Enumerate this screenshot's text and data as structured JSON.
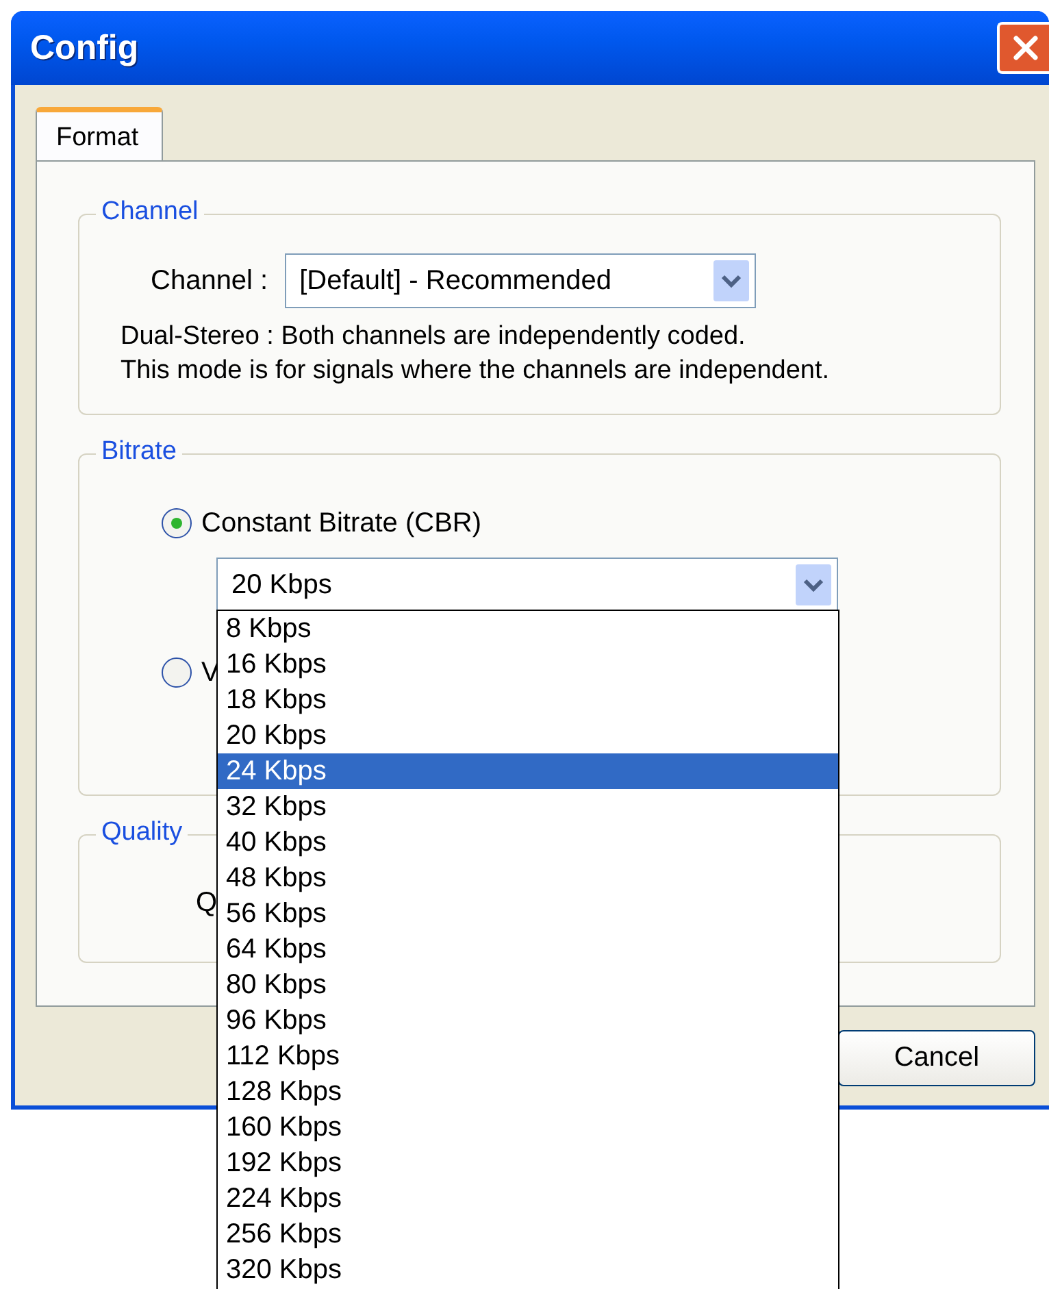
{
  "window": {
    "title": "Config"
  },
  "tabs": [
    {
      "label": "Format",
      "selected": true
    }
  ],
  "channel_group": {
    "legend": "Channel",
    "label": "Channel :",
    "value": "[Default] - Recommended",
    "description": [
      "Dual-Stereo : Both channels are independently coded.",
      "This mode is for signals where the channels are independent."
    ]
  },
  "bitrate_group": {
    "legend": "Bitrate",
    "options": [
      {
        "label": "Constant Bitrate (CBR)",
        "selected": true
      },
      {
        "label": "V",
        "selected": false
      }
    ],
    "value": "20 Kbps"
  },
  "quality_group": {
    "legend": "Quality",
    "label": "Q"
  },
  "buttons": [
    "Cancel"
  ],
  "dropdown_list": [
    {
      "label": "8 Kbps",
      "selected": false
    },
    {
      "label": "16 Kbps",
      "selected": false
    },
    {
      "label": "18 Kbps",
      "selected": false
    },
    {
      "label": "20 Kbps",
      "selected": false
    },
    {
      "label": "24 Kbps",
      "selected": true
    },
    {
      "label": "32 Kbps",
      "selected": false
    },
    {
      "label": "40 Kbps",
      "selected": false
    },
    {
      "label": "48 Kbps",
      "selected": false
    },
    {
      "label": "56 Kbps",
      "selected": false
    },
    {
      "label": "64 Kbps",
      "selected": false
    },
    {
      "label": "80 Kbps",
      "selected": false
    },
    {
      "label": "96 Kbps",
      "selected": false
    },
    {
      "label": "112 Kbps",
      "selected": false
    },
    {
      "label": "128 Kbps",
      "selected": false
    },
    {
      "label": "160 Kbps",
      "selected": false
    },
    {
      "label": "192 Kbps",
      "selected": false
    },
    {
      "label": "224 Kbps",
      "selected": false
    },
    {
      "label": "256 Kbps",
      "selected": false
    },
    {
      "label": "320 Kbps",
      "selected": false
    }
  ]
}
